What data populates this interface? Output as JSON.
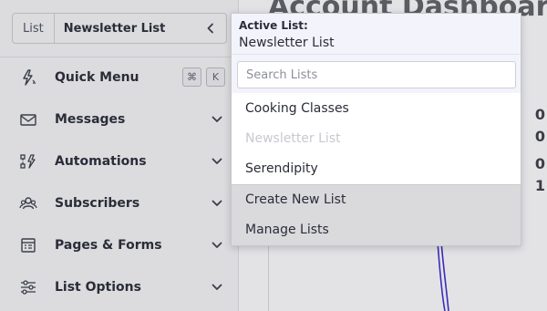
{
  "sidebar": {
    "list_tag": "List",
    "list_name": "Newsletter List",
    "shortcut_keys": [
      "⌘",
      "K"
    ],
    "items": [
      {
        "label": "Quick Menu",
        "icon": "lightning-cursor-icon"
      },
      {
        "label": "Messages",
        "icon": "envelope-icon"
      },
      {
        "label": "Automations",
        "icon": "automation-flow-icon"
      },
      {
        "label": "Subscribers",
        "icon": "users-icon"
      },
      {
        "label": "Pages & Forms",
        "icon": "page-layout-icon"
      },
      {
        "label": "List Options",
        "icon": "sliders-icon"
      }
    ]
  },
  "main": {
    "title": "Account Dashboard",
    "stats": [
      "0",
      "0",
      "0",
      "1"
    ]
  },
  "dropdown": {
    "active_label": "Active List:",
    "active_name": "Newsletter List",
    "search_placeholder": "Search Lists",
    "lists": [
      {
        "name": "Cooking Classes",
        "disabled": false
      },
      {
        "name": "Newsletter List",
        "disabled": true
      },
      {
        "name": "Serendipity",
        "disabled": false
      }
    ],
    "actions": [
      "Create New List",
      "Manage Lists"
    ]
  },
  "colors": {
    "accent_line": "#3b2db8",
    "text_primary": "#2a2d38",
    "text_disabled": "#c7c9d0"
  }
}
